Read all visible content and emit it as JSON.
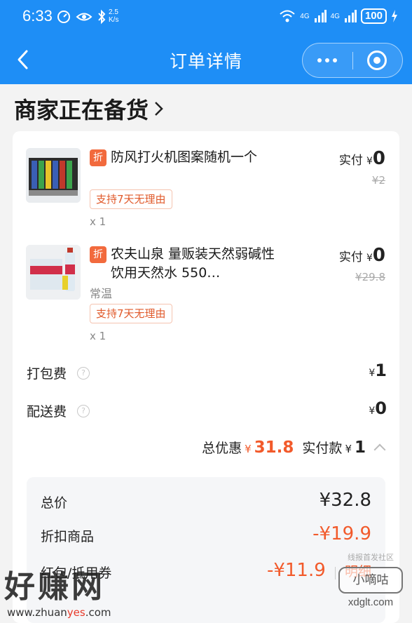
{
  "status_bar": {
    "time": "6:33",
    "net_speed": "2.5",
    "net_unit": "K/s",
    "signal1": "4G",
    "signal2": "4G",
    "battery": "100"
  },
  "nav": {
    "title": "订单详情"
  },
  "order": {
    "status_heading": "商家正在备货",
    "items": [
      {
        "tag": "折",
        "name": "防风打火机图案随机一个",
        "spec": "",
        "badge": "支持7天无理由",
        "qty": "x 1",
        "paid_label": "实付",
        "currency": "¥",
        "paid_amount": "0",
        "original": "¥2"
      },
      {
        "tag": "折",
        "name": "农夫山泉 量贩装天然弱碱性饮用天然水 550…",
        "spec": "常温",
        "badge": "支持7天无理由",
        "qty": "x 1",
        "paid_label": "实付",
        "currency": "¥",
        "paid_amount": "0",
        "original": "¥29.8"
      }
    ],
    "fees": [
      {
        "label": "打包费",
        "currency": "¥",
        "amount": "1"
      },
      {
        "label": "配送费",
        "currency": "¥",
        "amount": "0"
      }
    ],
    "summary": {
      "discount_label": "总优惠",
      "discount_currency": "¥",
      "discount_amount": "31.8",
      "paid_label": "实付款",
      "paid_currency": "¥",
      "paid_amount": "1"
    },
    "price_detail": {
      "total_label": "总价",
      "total_value": "¥32.8",
      "discount_goods_label": "折扣商品",
      "discount_goods_value": "-¥19.9",
      "coupon_label": "红包/抵用券",
      "coupon_value": "-¥11.9",
      "detail_link": "明细"
    }
  },
  "watermarks": {
    "left_big": "好赚网",
    "left_small_a": "www.zhuan",
    "left_small_b": "yes",
    "left_small_c": ".com",
    "right_top": "线报首发社区",
    "right_box": "小嘀咕",
    "right_url": "xdglt.com"
  },
  "colors": {
    "header_blue": "#1e8ef6",
    "accent_red": "#f25a2b"
  }
}
